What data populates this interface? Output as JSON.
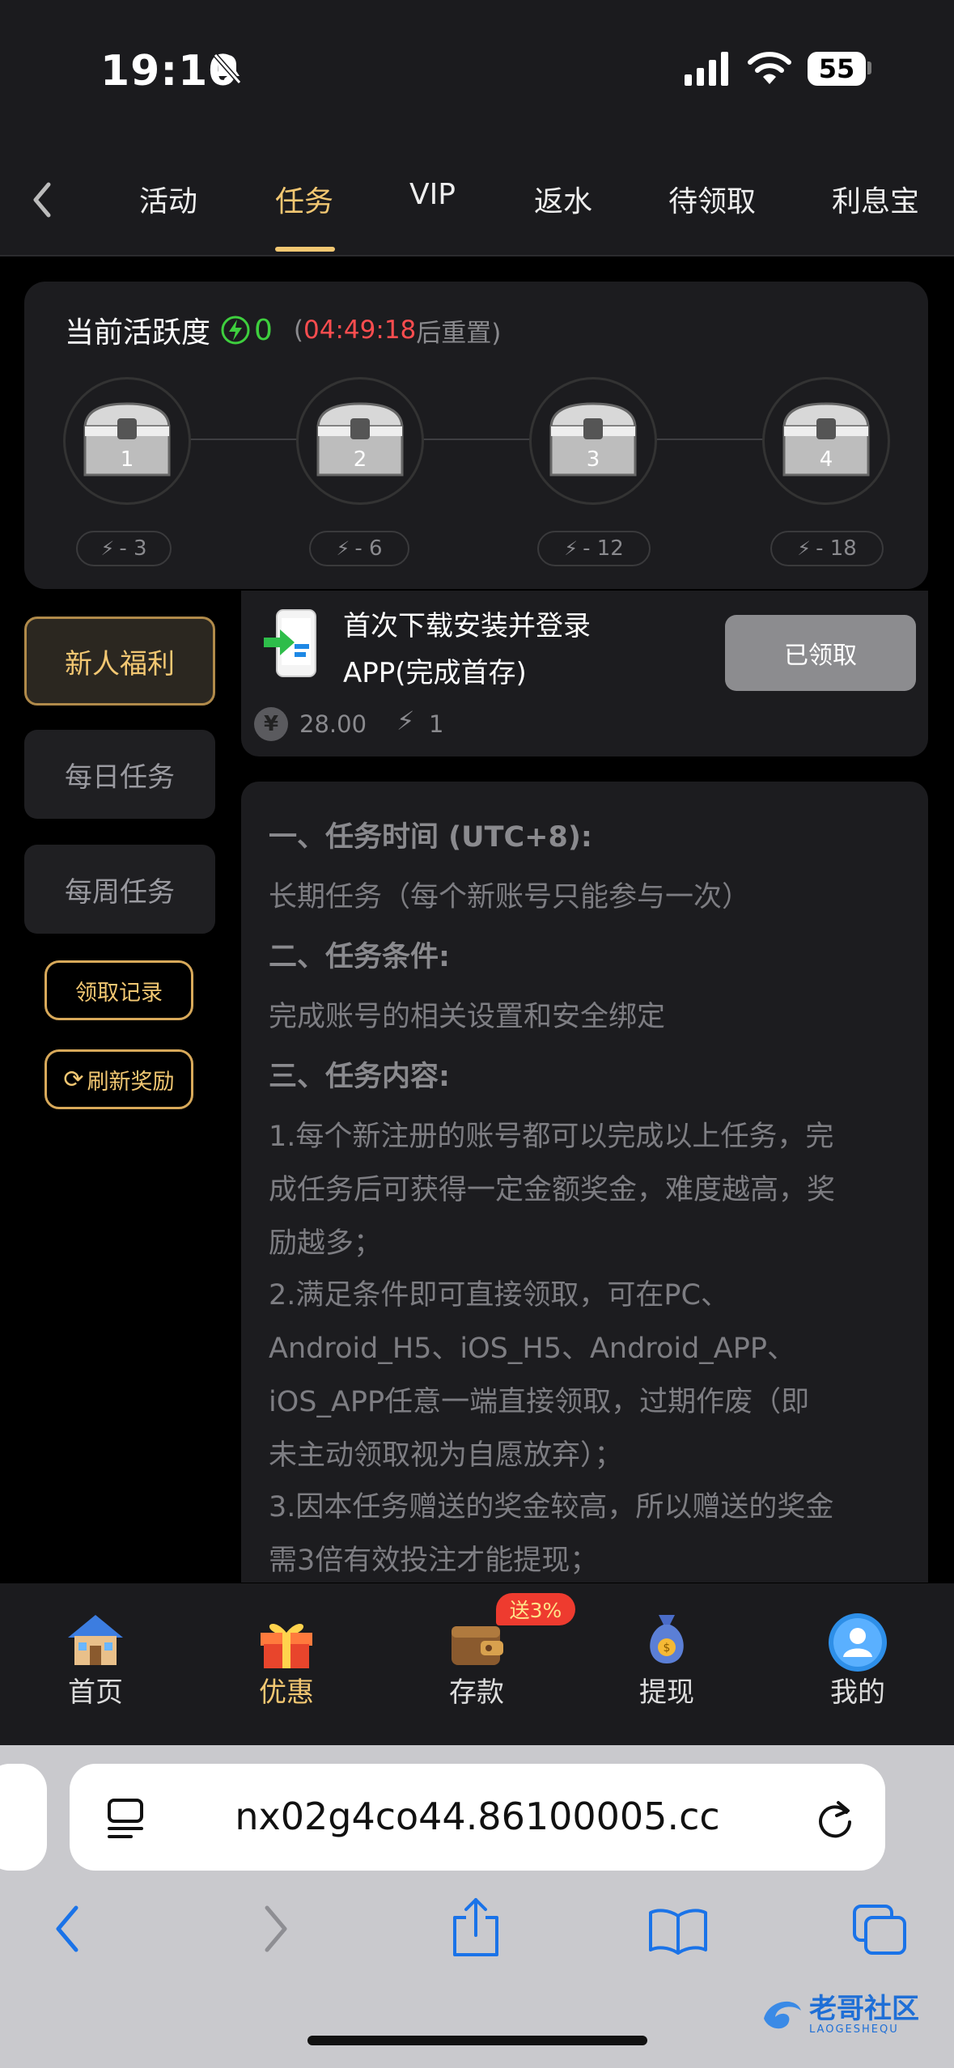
{
  "status_bar": {
    "time": "19:10",
    "battery": "55"
  },
  "top_nav": {
    "back_icon": "chevron-left-icon",
    "tabs": [
      {
        "label": "活动",
        "active": false
      },
      {
        "label": "任务",
        "active": true
      },
      {
        "label": "VIP",
        "active": false
      },
      {
        "label": "返水",
        "active": false
      },
      {
        "label": "待领取",
        "active": false
      },
      {
        "label": "利息宝",
        "active": false
      }
    ]
  },
  "activity": {
    "title": "当前活跃度",
    "value": "0",
    "paren_open": "(",
    "countdown": "04:49:18",
    "reset_text": "后重置)",
    "chests": [
      {
        "number": "1",
        "cost": "- 3"
      },
      {
        "number": "2",
        "cost": "- 6"
      },
      {
        "number": "3",
        "cost": "- 12"
      },
      {
        "number": "4",
        "cost": "- 18"
      }
    ]
  },
  "sidebar": {
    "items": [
      {
        "label": "新人福利",
        "active": true
      },
      {
        "label": "每日任务",
        "active": false
      },
      {
        "label": "每周任务",
        "active": false
      }
    ],
    "record_button": "领取记录",
    "refresh_button": "刷新奖励"
  },
  "task": {
    "title_line1": "首次下载安装并登录",
    "title_line2": "APP(完成首存)",
    "reward_amount": "28.00",
    "reward_activity": "1",
    "button": "已领取"
  },
  "description": [
    {
      "text": "一、任务时间 (UTC+8):",
      "heading": true
    },
    {
      "text": "长期任务（每个新账号只能参与一次）",
      "heading": false
    },
    {
      "text": "二、任务条件:",
      "heading": true
    },
    {
      "text": "完成账号的相关设置和安全绑定",
      "heading": false
    },
    {
      "text": "三、任务内容:",
      "heading": true
    },
    {
      "text": "1.每个新注册的账号都可以完成以上任务，完",
      "heading": false
    },
    {
      "text": "成任务后可获得一定金额奖金，难度越高，奖",
      "heading": false
    },
    {
      "text": "励越多；",
      "heading": false
    },
    {
      "text": "2.满足条件即可直接领取，可在PC、",
      "heading": false
    },
    {
      "text": "Android_H5、iOS_H5、Android_APP、",
      "heading": false
    },
    {
      "text": "iOS_APP任意一端直接领取，过期作废（即",
      "heading": false
    },
    {
      "text": "未主动领取视为自愿放弃）；",
      "heading": false
    },
    {
      "text": "3.因本任务赠送的奖金较高，所以赠送的奖金",
      "heading": false
    },
    {
      "text": "需3倍有效投注才能提现；",
      "heading": false
    }
  ],
  "bottom_nav": [
    {
      "label": "首页",
      "icon": "house-icon",
      "active": false
    },
    {
      "label": "优惠",
      "icon": "gift-icon",
      "active": true
    },
    {
      "label": "存款",
      "icon": "wallet-icon",
      "active": false,
      "badge": "送3%"
    },
    {
      "label": "提现",
      "icon": "money-bag-icon",
      "active": false
    },
    {
      "label": "我的",
      "icon": "avatar-icon",
      "active": false
    }
  ],
  "browser": {
    "url": "nx02g4co44.86100005.cc"
  },
  "watermark": {
    "text": "老哥社区",
    "sub": "LAOGESHEQU"
  },
  "colors": {
    "accent": "#f2c772",
    "countdown": "#ff4d4f",
    "energy": "#3ecf3e"
  }
}
